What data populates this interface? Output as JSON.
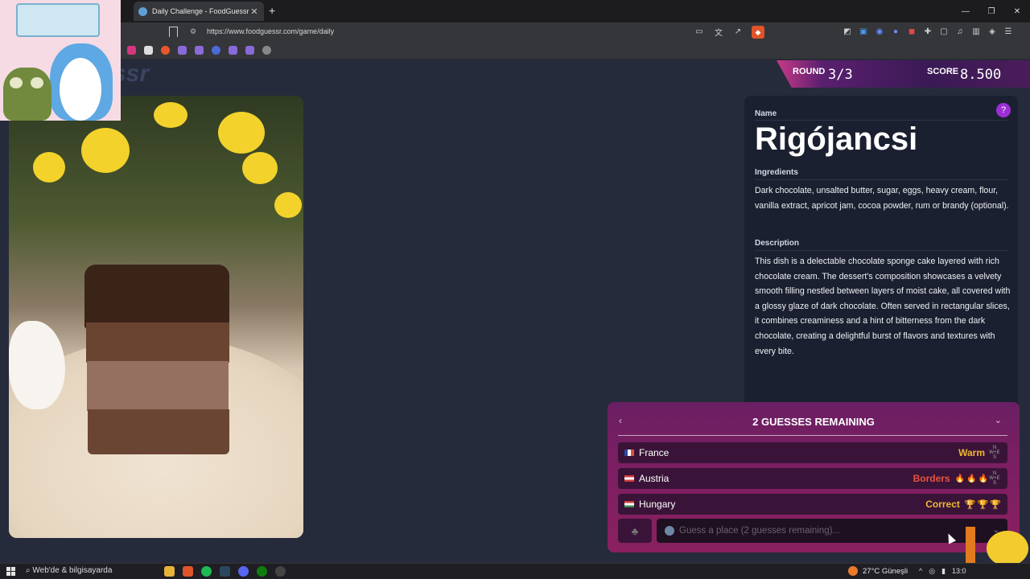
{
  "browser": {
    "tab_title": "Daily Challenge - FoodGuessr | F",
    "url": "https://www.foodguessr.com/game/daily"
  },
  "header": {
    "logo_partial": "ssr",
    "round_label": "ROUND",
    "round_value": "3/3",
    "score_label": "SCORE",
    "score_value": "8.500"
  },
  "dish": {
    "name_label": "Name",
    "name": "Rigójancsi",
    "ingredients_label": "Ingredients",
    "ingredients": "Dark chocolate, unsalted butter, sugar, eggs, heavy cream, flour, vanilla extract, apricot jam, cocoa powder, rum or brandy (optional).",
    "description_label": "Description",
    "description": "This dish is a delectable chocolate sponge cake layered with rich chocolate cream. The dessert's composition showcases a velvety smooth filling nestled between layers of moist cake, all covered with a glossy glaze of dark chocolate. Often served in rectangular slices, it combines creaminess and a hint of bitterness from the dark chocolate, creating a delightful burst of flavors and textures with every bite."
  },
  "guesses": {
    "title": "2 GUESSES REMAINING",
    "rows": [
      {
        "country": "France",
        "result": "Warm",
        "result_color": "#f0b82f"
      },
      {
        "country": "Austria",
        "result": "Borders",
        "result_color": "#e8533f"
      },
      {
        "country": "Hungary",
        "result": "Correct",
        "result_color": "#f0b82f"
      }
    ],
    "input_placeholder": "Guess a place (2 guesses remaining)..."
  },
  "compass": {
    "n": "N",
    "w": "W",
    "e": "E",
    "s": "S"
  },
  "taskbar": {
    "search_text": "Web'de & bilgisayarda",
    "weather": "27°C Güneşli",
    "time": "13:0"
  },
  "colors": {
    "page_bg": "#262b3b",
    "panel_bg": "#1b2030",
    "guess_panel": "#7a1f62",
    "accent_purple": "#9b2fd4"
  }
}
